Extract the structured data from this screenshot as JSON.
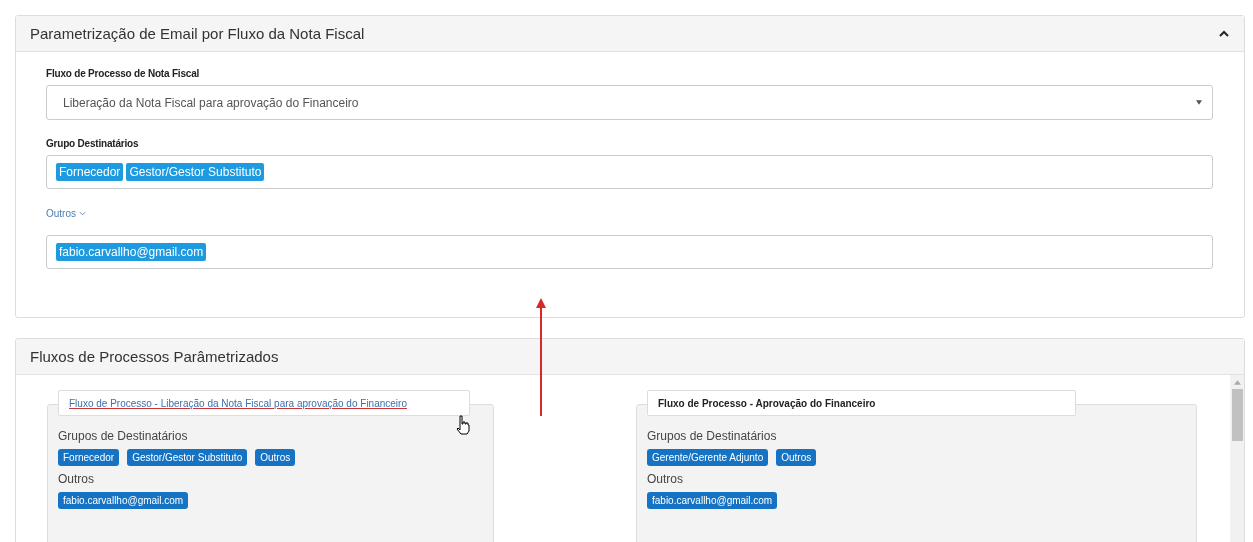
{
  "email_panel": {
    "title": "Parametrização de Email por Fluxo da Nota Fiscal",
    "expanded": true,
    "flow_label": "Fluxo de Processo de Nota Fiscal",
    "flow_value": "Liberação da Nota Fiscal para aprovação do Financeiro",
    "groups_label": "Grupo Destinatários",
    "groups": [
      "Fornecedor",
      "Gestor/Gestor Substituto"
    ],
    "others_toggle": "Outros",
    "others_expanded": true,
    "emails": [
      "fabio.carvallho@gmail.com"
    ]
  },
  "flows_panel": {
    "title": "Fluxos de Processos Parâmetrizados",
    "cards": [
      {
        "title": "Fluxo de Processo - Liberação da Nota Fiscal para aprovação do Financeiro",
        "kind": "link",
        "groups_label": "Grupos de Destinatários",
        "groups": [
          "Fornecedor",
          "Gestor/Gestor Substituto",
          "Outros"
        ],
        "others_label": "Outros",
        "emails": [
          "fabio.carvallho@gmail.com"
        ]
      },
      {
        "title": "Fluxo de Processo - Aprovação do Financeiro",
        "kind": "text",
        "groups_label": "Grupos de Destinatários",
        "groups": [
          "Gerente/Gerente Adjunto",
          "Outros"
        ],
        "others_label": "Outros",
        "emails": [
          "fabio.carvallho@gmail.com"
        ]
      }
    ]
  }
}
